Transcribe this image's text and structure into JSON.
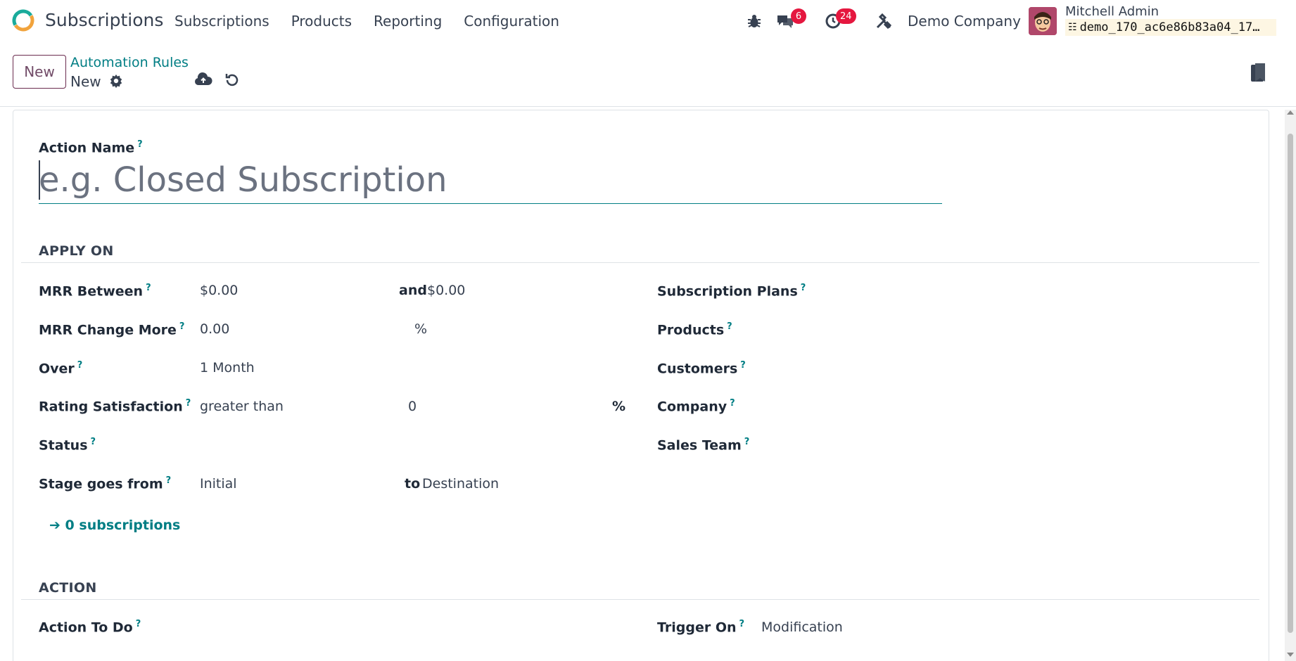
{
  "navbar": {
    "app_name": "Subscriptions",
    "menu": [
      "Subscriptions",
      "Products",
      "Reporting",
      "Configuration"
    ],
    "messages_count": "6",
    "activities_count": "24",
    "company": "Demo Company",
    "user_name": "Mitchell Admin",
    "database": "demo_170_ac6e86b83a04_17…"
  },
  "control_panel": {
    "new_label": "New",
    "breadcrumb_parent": "Automation Rules",
    "breadcrumb_current": "New"
  },
  "form": {
    "action_name_label": "Action Name",
    "action_name_placeholder": "e.g. Closed Subscription",
    "apply_on_title": "APPLY ON",
    "mrr_between_label": "MRR Between",
    "mrr_min": "$0.00",
    "and_label": "and",
    "mrr_max": "$0.00",
    "mrr_change_label": "MRR Change More",
    "mrr_change_value": "0.00",
    "mrr_change_unit": "%",
    "over_label": "Over",
    "over_value": "1 Month",
    "rating_label": "Rating Satisfaction",
    "rating_operator": "greater than",
    "rating_value": "0",
    "rating_unit": "%",
    "status_label": "Status",
    "stage_from_label": "Stage goes from",
    "stage_from_value": "Initial",
    "to_label": "to",
    "stage_to_value": "Destination",
    "subscription_plans_label": "Subscription Plans",
    "products_label": "Products",
    "customers_label": "Customers",
    "company_label": "Company",
    "sales_team_label": "Sales Team",
    "smart_link": "0 subscriptions",
    "action_title": "ACTION",
    "action_to_do_label": "Action To Do",
    "trigger_on_label": "Trigger On",
    "trigger_on_value": "Modification"
  },
  "colors": {
    "accent_teal": "#017e84",
    "brand_purple": "#714b67",
    "badge_red": "#e5173f"
  }
}
